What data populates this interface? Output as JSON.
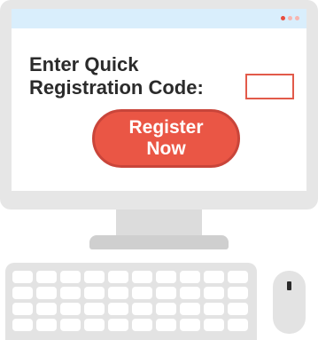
{
  "prompt": {
    "line1": "Enter Quick",
    "line2": "Registration Code:"
  },
  "code_input": {
    "value": "",
    "placeholder": ""
  },
  "register_button": {
    "line1": "Register",
    "line2": "Now"
  },
  "window_dots": [
    "#e84c3d",
    "#f7b6b0",
    "#f7b6b0"
  ],
  "colors": {
    "accent": "#ea5645",
    "accent_border": "#c9453a",
    "titlebar": "#d9eefc",
    "text": "#2b2b2b",
    "device": "#e3e3e3"
  },
  "keyboard": {
    "rows": 4,
    "keys_per_row": 10
  },
  "icons": {
    "monitor": "monitor-icon",
    "keyboard": "keyboard-icon",
    "mouse": "mouse-icon"
  }
}
